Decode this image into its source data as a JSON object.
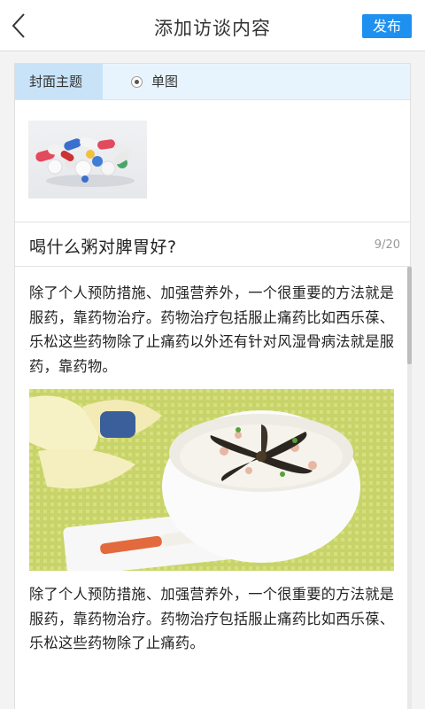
{
  "header": {
    "title": "添加访谈内容",
    "publish_label": "发布"
  },
  "cover": {
    "label": "封面主题",
    "option_label": "单图",
    "thumb_icon": "pills-image"
  },
  "article": {
    "title": "喝什么粥对脾胃好?",
    "count": "9/20",
    "paragraph1": "除了个人预防措施、加强营养外，一个很重要的方法就是服药，靠药物治疗。药物治疗包括服止痛药比如西乐葆、乐松这些药物除了止痛药以外还有针对风湿骨病法就是服药，靠药物。",
    "image_icon": "congee-bowl-image",
    "paragraph2": "除了个人预防措施、加强营养外，一个很重要的方法就是服药，靠药物治疗。药物治疗包括服止痛药比如西乐葆、乐松这些药物除了止痛药。"
  },
  "colors": {
    "accent": "#1e90f0",
    "cover_label_bg": "#c8e3f8",
    "cover_row_bg": "#e8f4fd"
  }
}
